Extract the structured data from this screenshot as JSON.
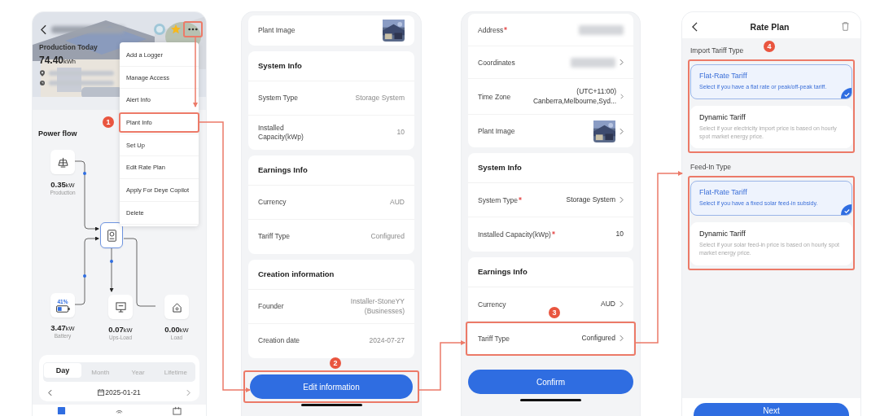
{
  "home_screen": {
    "menu_button_highlighted": true,
    "production_label": "Production Today",
    "production_value": "74.40",
    "production_unit": "kWh",
    "menu": [
      {
        "label": "Add a Logger",
        "highlighted": false
      },
      {
        "label": "Manage Access",
        "highlighted": false
      },
      {
        "label": "Alert Info",
        "highlighted": false
      },
      {
        "label": "Plant Info",
        "highlighted": true
      },
      {
        "label": "Set Up",
        "highlighted": false
      },
      {
        "label": "Edit Rate Plan",
        "highlighted": false
      },
      {
        "label": "Apply For Deye Copilot",
        "highlighted": false
      },
      {
        "label": "Delete",
        "highlighted": false
      }
    ],
    "power_flow_title": "Power flow",
    "nodes": [
      {
        "kind": "production",
        "value": "0.35",
        "unit": "kW",
        "label": "Production"
      },
      {
        "kind": "battery",
        "value": "3.47",
        "unit": "kW",
        "label": "Battery",
        "percent": "41%"
      },
      {
        "kind": "ups",
        "value": "0.07",
        "unit": "kW",
        "label": "Ups-Load"
      },
      {
        "kind": "load",
        "value": "0.00",
        "unit": "kW",
        "label": "Load"
      }
    ],
    "period_tabs": [
      {
        "label": "Day",
        "selected": true
      },
      {
        "label": "Month",
        "selected": false
      },
      {
        "label": "Year",
        "selected": false
      },
      {
        "label": "Lifetime",
        "selected": false
      }
    ],
    "date": "2025-01-21"
  },
  "plant_info_screen": {
    "cards": [
      {
        "rows": [
          {
            "label": "Plant Image"
          }
        ]
      },
      {
        "title": "System Info",
        "rows": [
          {
            "kind": "text",
            "label": "System Type",
            "value": "Storage System"
          },
          {
            "kind": "text",
            "label": "Installed Capacity(kWp)",
            "value": "10"
          }
        ]
      },
      {
        "title": "Earnings Info",
        "rows": [
          {
            "kind": "text",
            "label": "Currency",
            "value": "AUD"
          },
          {
            "kind": "text",
            "label": "Tariff Type",
            "value": "Configured"
          }
        ]
      },
      {
        "title": "Creation information",
        "rows": [
          {
            "kind": "text",
            "label": "Founder",
            "value": "Installer-StoneYY (Businesses)"
          },
          {
            "kind": "text",
            "label": "Creation date",
            "value": "2024-07-27"
          }
        ]
      }
    ],
    "button": {
      "label": "Edit information",
      "highlighted": true
    }
  },
  "edit_screen": {
    "cards": [
      {
        "rows": [
          {
            "kind": "blurred",
            "label": "Address",
            "required": true,
            "chevron": false,
            "highlighted": false
          },
          {
            "kind": "blurred",
            "label": "Coordinates",
            "required": false,
            "chevron": true,
            "highlighted": false
          },
          {
            "kind": "text",
            "label": "Time Zone",
            "value": "(UTC+11:00) Canberra,Melbourne,Syd...",
            "required": false,
            "chevron": true,
            "highlighted": false
          },
          {
            "label": "Plant Image",
            "required": false,
            "chevron": true,
            "highlighted": false
          }
        ]
      },
      {
        "title": "System Info",
        "rows": [
          {
            "kind": "text",
            "label": "System Type",
            "value": "Storage System",
            "required": true,
            "chevron": true,
            "highlighted": false
          },
          {
            "kind": "text",
            "label": "Installed Capacity(kWp)",
            "value": "10",
            "required": true,
            "chevron": false,
            "highlighted": false
          }
        ]
      },
      {
        "title": "Earnings Info",
        "rows": [
          {
            "kind": "text",
            "label": "Currency",
            "value": "AUD",
            "required": false,
            "chevron": true,
            "highlighted": false
          },
          {
            "kind": "text",
            "label": "Tariff Type",
            "value": "Configured",
            "required": false,
            "chevron": true,
            "highlighted": true
          }
        ]
      }
    ],
    "button": {
      "label": "Confirm"
    }
  },
  "rate_plan_screen": {
    "title": "Rate Plan",
    "sections": [
      {
        "title": "Import Tariff Type",
        "highlighted": true,
        "options": [
          {
            "name": "Flat-Rate Tariff",
            "description": "Select if you have a flat rate or peak/off-peak tariff.",
            "selected": true
          },
          {
            "name": "Dynamic Tariff",
            "description": "Select if your electricity import price is based on hourly spot market energy price.",
            "selected": false
          }
        ]
      },
      {
        "title": "Feed-In Type",
        "highlighted": true,
        "options": [
          {
            "name": "Flat-Rate Tariff",
            "description": "Select if you have a fixed solar feed-in subsidy.",
            "selected": true
          },
          {
            "name": "Dynamic Tariff",
            "description": "Select if your solar feed-in price is based on hourly spot market energy price.",
            "selected": false
          }
        ]
      }
    ],
    "button": {
      "label": "Next"
    }
  },
  "callouts": [
    {
      "label": "1"
    },
    {
      "label": "2"
    },
    {
      "label": "3"
    },
    {
      "label": "4"
    }
  ]
}
